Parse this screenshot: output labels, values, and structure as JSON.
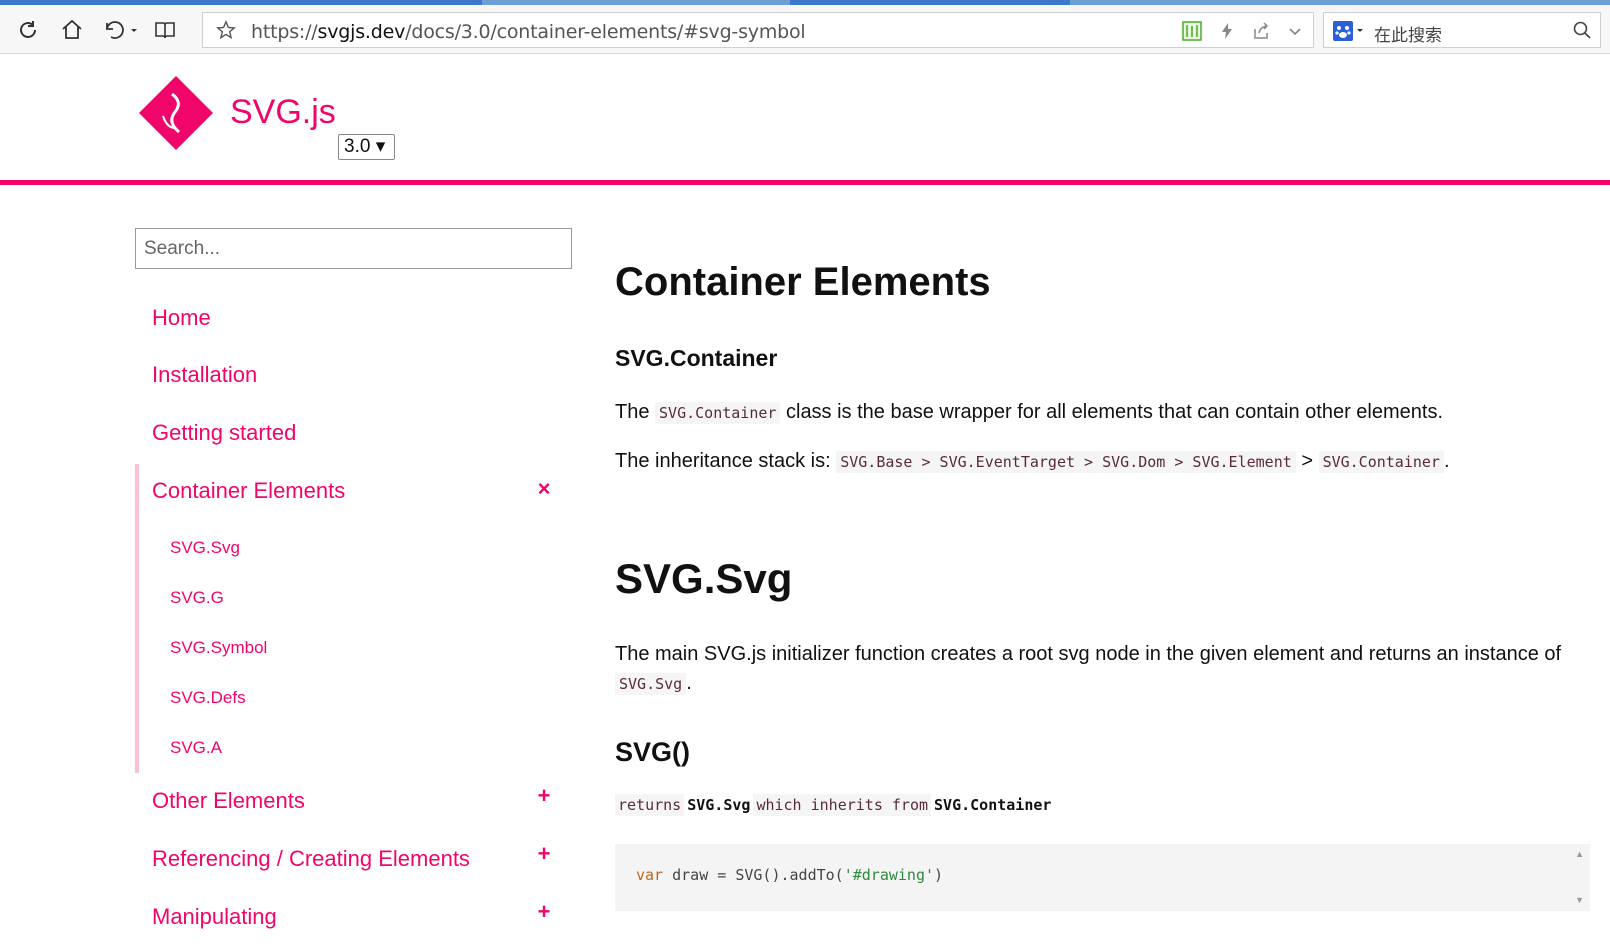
{
  "browser": {
    "url_prefix": "https://",
    "url_host": "svgjs.dev",
    "url_path": "/docs/3.0/container-elements/#svg-symbol",
    "search_placeholder": "在此搜索"
  },
  "header": {
    "brand": "SVG.js",
    "version": "3.0 ▾"
  },
  "sidebar": {
    "search_placeholder": "Search...",
    "items": [
      {
        "label": "Home"
      },
      {
        "label": "Installation"
      },
      {
        "label": "Getting started"
      },
      {
        "label": "Container Elements",
        "toggle": "×"
      },
      {
        "label": "Other Elements",
        "toggle": "+"
      },
      {
        "label": "Referencing / Creating Elements",
        "toggle": "+"
      },
      {
        "label": "Manipulating",
        "toggle": "+"
      }
    ],
    "subitems": [
      {
        "label": "SVG.Svg"
      },
      {
        "label": "SVG.G"
      },
      {
        "label": "SVG.Symbol"
      },
      {
        "label": "SVG.Defs"
      },
      {
        "label": "SVG.A"
      }
    ]
  },
  "content": {
    "title": "Container Elements",
    "container_heading": "SVG.Container",
    "p1_pre": "The ",
    "p1_code": "SVG.Container",
    "p1_post": " class is the base wrapper for all elements that can contain other elements.",
    "p2_pre": "The inheritance stack is: ",
    "p2_code1": "SVG.Base > SVG.EventTarget > SVG.Dom > SVG.Element",
    "p2_sep": " > ",
    "p2_code2": "SVG.Container",
    "p2_post": ".",
    "svg_heading": "SVG.Svg",
    "p3_line1": "The main SVG.js initializer function creates a root svg node in the given element and returns an instance of",
    "p3_code": "SVG.Svg",
    "p3_post": ".",
    "fn_heading": "SVG()",
    "returns_kw1": "returns",
    "returns_type1": "SVG.Svg",
    "returns_kw2": "which inherits from",
    "returns_type2": "SVG.Container",
    "code_var": "var",
    "code_mid": " draw = SVG().addTo(",
    "code_str": "'#drawing'",
    "code_end": ")"
  },
  "colors": {
    "accent": "#f0056b",
    "code_bg": "#f3f4f3"
  }
}
